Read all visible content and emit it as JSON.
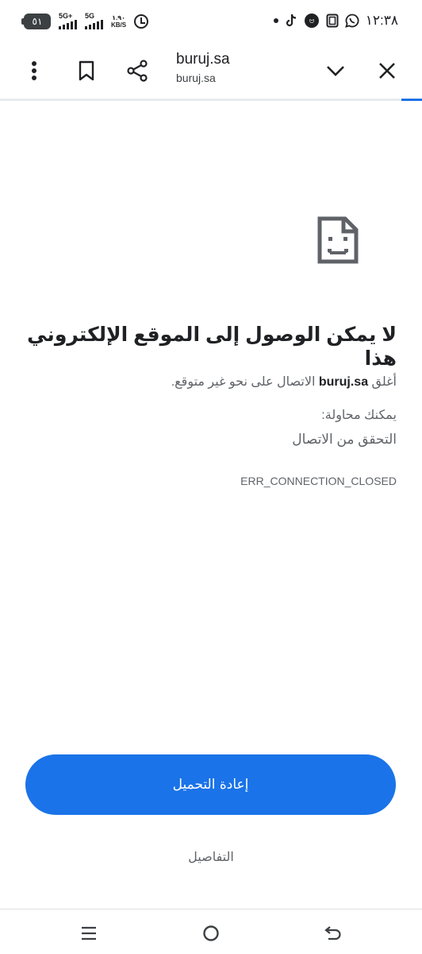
{
  "status_bar": {
    "battery": "٥١",
    "network1": "5G+",
    "network2": "5G",
    "speed_value": "١.٩٠",
    "speed_unit": "KB/S",
    "time": "١٢:٣٨"
  },
  "toolbar": {
    "title": "buruj.sa",
    "url": "buruj.sa"
  },
  "error": {
    "title": "لا يمكن الوصول إلى الموقع الإلكتروني هذا",
    "desc_prefix": "أغلق ",
    "desc_domain": "buruj.sa",
    "desc_suffix": " الاتصال على نحو غير متوقع.",
    "try_label": "يمكنك محاولة:",
    "try_item": "التحقق من الاتصال",
    "code": "ERR_CONNECTION_CLOSED"
  },
  "buttons": {
    "reload": "إعادة التحميل",
    "details": "التفاصيل"
  },
  "colors": {
    "accent": "#1a73e8",
    "text": "#202124",
    "secondary": "#5f6368"
  }
}
